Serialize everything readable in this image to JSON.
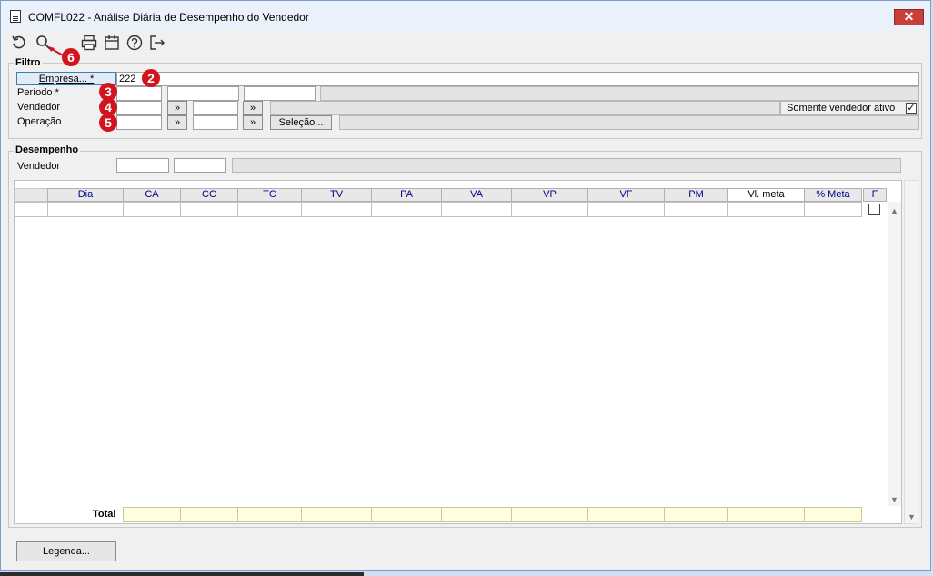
{
  "window": {
    "title": "COMFL022 - Análise Diária de Desempenho do Vendedor",
    "close_glyph": "✕"
  },
  "toolbar": {
    "items": [
      "refresh-icon",
      "search-icon",
      "print-icon",
      "calendar-icon",
      "help-icon",
      "exit-icon"
    ]
  },
  "badges": [
    "2",
    "3",
    "4",
    "5",
    "6"
  ],
  "filtro": {
    "label": "Filtro",
    "empresa_button": "Empresa... *",
    "empresa_value": "222",
    "periodo_label": "Período *",
    "vendedor_label": "Vendedor",
    "operacao_label": "Operação",
    "lookup_button": "»",
    "selecao_button": "Seleção...",
    "somente_label": "Somente vendedor ativo",
    "somente_checked": true,
    "check_glyph": "✓"
  },
  "desempenho": {
    "label": "Desempenho",
    "vendedor_label": "Vendedor"
  },
  "grid": {
    "columns": [
      "Dia",
      "CA",
      "CC",
      "TC",
      "TV",
      "PA",
      "VA",
      "VP",
      "VF",
      "PM",
      "Vl. meta",
      "% Meta",
      "F"
    ],
    "total_label": "Total"
  },
  "footer": {
    "legenda_button": "Legenda..."
  },
  "colors": {
    "header_text": "#00008b",
    "total_bg": "#ffffdd",
    "badge": "#d2141e"
  }
}
